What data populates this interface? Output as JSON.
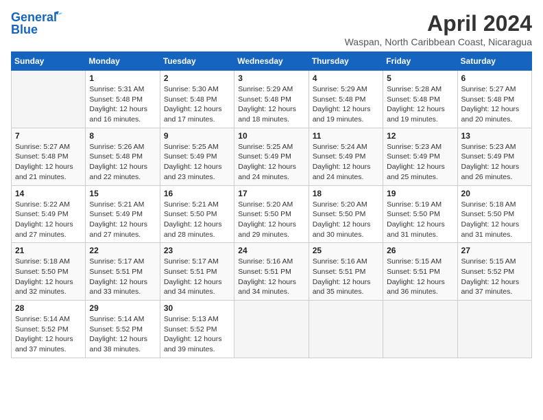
{
  "header": {
    "logo_line1": "General",
    "logo_line2": "Blue",
    "title": "April 2024",
    "location": "Waspan, North Caribbean Coast, Nicaragua"
  },
  "columns": [
    "Sunday",
    "Monday",
    "Tuesday",
    "Wednesday",
    "Thursday",
    "Friday",
    "Saturday"
  ],
  "weeks": [
    [
      {
        "num": "",
        "info": ""
      },
      {
        "num": "1",
        "info": "Sunrise: 5:31 AM\nSunset: 5:48 PM\nDaylight: 12 hours\nand 16 minutes."
      },
      {
        "num": "2",
        "info": "Sunrise: 5:30 AM\nSunset: 5:48 PM\nDaylight: 12 hours\nand 17 minutes."
      },
      {
        "num": "3",
        "info": "Sunrise: 5:29 AM\nSunset: 5:48 PM\nDaylight: 12 hours\nand 18 minutes."
      },
      {
        "num": "4",
        "info": "Sunrise: 5:29 AM\nSunset: 5:48 PM\nDaylight: 12 hours\nand 19 minutes."
      },
      {
        "num": "5",
        "info": "Sunrise: 5:28 AM\nSunset: 5:48 PM\nDaylight: 12 hours\nand 19 minutes."
      },
      {
        "num": "6",
        "info": "Sunrise: 5:27 AM\nSunset: 5:48 PM\nDaylight: 12 hours\nand 20 minutes."
      }
    ],
    [
      {
        "num": "7",
        "info": "Sunrise: 5:27 AM\nSunset: 5:48 PM\nDaylight: 12 hours\nand 21 minutes."
      },
      {
        "num": "8",
        "info": "Sunrise: 5:26 AM\nSunset: 5:48 PM\nDaylight: 12 hours\nand 22 minutes."
      },
      {
        "num": "9",
        "info": "Sunrise: 5:25 AM\nSunset: 5:49 PM\nDaylight: 12 hours\nand 23 minutes."
      },
      {
        "num": "10",
        "info": "Sunrise: 5:25 AM\nSunset: 5:49 PM\nDaylight: 12 hours\nand 24 minutes."
      },
      {
        "num": "11",
        "info": "Sunrise: 5:24 AM\nSunset: 5:49 PM\nDaylight: 12 hours\nand 24 minutes."
      },
      {
        "num": "12",
        "info": "Sunrise: 5:23 AM\nSunset: 5:49 PM\nDaylight: 12 hours\nand 25 minutes."
      },
      {
        "num": "13",
        "info": "Sunrise: 5:23 AM\nSunset: 5:49 PM\nDaylight: 12 hours\nand 26 minutes."
      }
    ],
    [
      {
        "num": "14",
        "info": "Sunrise: 5:22 AM\nSunset: 5:49 PM\nDaylight: 12 hours\nand 27 minutes."
      },
      {
        "num": "15",
        "info": "Sunrise: 5:21 AM\nSunset: 5:49 PM\nDaylight: 12 hours\nand 27 minutes."
      },
      {
        "num": "16",
        "info": "Sunrise: 5:21 AM\nSunset: 5:50 PM\nDaylight: 12 hours\nand 28 minutes."
      },
      {
        "num": "17",
        "info": "Sunrise: 5:20 AM\nSunset: 5:50 PM\nDaylight: 12 hours\nand 29 minutes."
      },
      {
        "num": "18",
        "info": "Sunrise: 5:20 AM\nSunset: 5:50 PM\nDaylight: 12 hours\nand 30 minutes."
      },
      {
        "num": "19",
        "info": "Sunrise: 5:19 AM\nSunset: 5:50 PM\nDaylight: 12 hours\nand 31 minutes."
      },
      {
        "num": "20",
        "info": "Sunrise: 5:18 AM\nSunset: 5:50 PM\nDaylight: 12 hours\nand 31 minutes."
      }
    ],
    [
      {
        "num": "21",
        "info": "Sunrise: 5:18 AM\nSunset: 5:50 PM\nDaylight: 12 hours\nand 32 minutes."
      },
      {
        "num": "22",
        "info": "Sunrise: 5:17 AM\nSunset: 5:51 PM\nDaylight: 12 hours\nand 33 minutes."
      },
      {
        "num": "23",
        "info": "Sunrise: 5:17 AM\nSunset: 5:51 PM\nDaylight: 12 hours\nand 34 minutes."
      },
      {
        "num": "24",
        "info": "Sunrise: 5:16 AM\nSunset: 5:51 PM\nDaylight: 12 hours\nand 34 minutes."
      },
      {
        "num": "25",
        "info": "Sunrise: 5:16 AM\nSunset: 5:51 PM\nDaylight: 12 hours\nand 35 minutes."
      },
      {
        "num": "26",
        "info": "Sunrise: 5:15 AM\nSunset: 5:51 PM\nDaylight: 12 hours\nand 36 minutes."
      },
      {
        "num": "27",
        "info": "Sunrise: 5:15 AM\nSunset: 5:52 PM\nDaylight: 12 hours\nand 37 minutes."
      }
    ],
    [
      {
        "num": "28",
        "info": "Sunrise: 5:14 AM\nSunset: 5:52 PM\nDaylight: 12 hours\nand 37 minutes."
      },
      {
        "num": "29",
        "info": "Sunrise: 5:14 AM\nSunset: 5:52 PM\nDaylight: 12 hours\nand 38 minutes."
      },
      {
        "num": "30",
        "info": "Sunrise: 5:13 AM\nSunset: 5:52 PM\nDaylight: 12 hours\nand 39 minutes."
      },
      {
        "num": "",
        "info": ""
      },
      {
        "num": "",
        "info": ""
      },
      {
        "num": "",
        "info": ""
      },
      {
        "num": "",
        "info": ""
      }
    ]
  ]
}
